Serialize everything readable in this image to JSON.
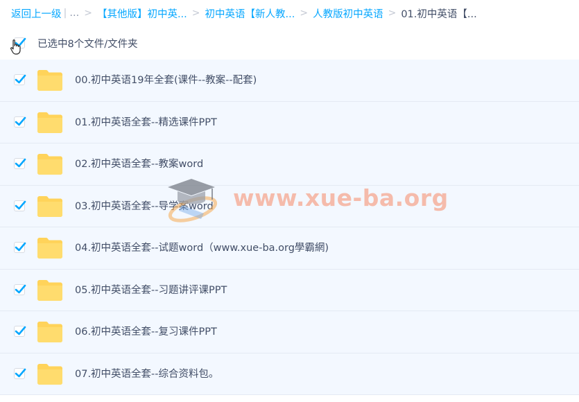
{
  "breadcrumb": {
    "back": "返回上一级",
    "ellipsis": "...",
    "items": [
      "【其他版】初中英...",
      "初中英语【新人教...",
      "人教版初中英语"
    ],
    "current": "01.初中英语【..."
  },
  "selection": {
    "label": "已选中8个文件/文件夹",
    "all_checked": true
  },
  "files": [
    {
      "name": "00.初中英语19年全套(课件--教案--配套)",
      "checked": true
    },
    {
      "name": "01.初中英语全套--精选课件PPT",
      "checked": true
    },
    {
      "name": "02.初中英语全套--教案word",
      "checked": true
    },
    {
      "name": "03.初中英语全套--导学案word",
      "checked": true
    },
    {
      "name": "04.初中英语全套--试题word（www.xue-ba.org學霸網)",
      "checked": true
    },
    {
      "name": "05.初中英语全套--习题讲评课PPT",
      "checked": true
    },
    {
      "name": "06.初中英语全套--复习课件PPT",
      "checked": true
    },
    {
      "name": "07.初中英语全套--综合资料包。",
      "checked": true
    }
  ],
  "watermark": {
    "text": "www.xue-ba.org"
  },
  "colors": {
    "link": "#06a7ff",
    "text": "#424e67",
    "check": "#06a7ff",
    "row_bg": "#f3f8ff",
    "folder": "#ffd35a"
  },
  "icons": {
    "checkbox": "checkmark-icon",
    "folder": "folder-icon",
    "cursor": "hand-pointer-icon",
    "watermark_logo": "graduation-cap-icon"
  }
}
